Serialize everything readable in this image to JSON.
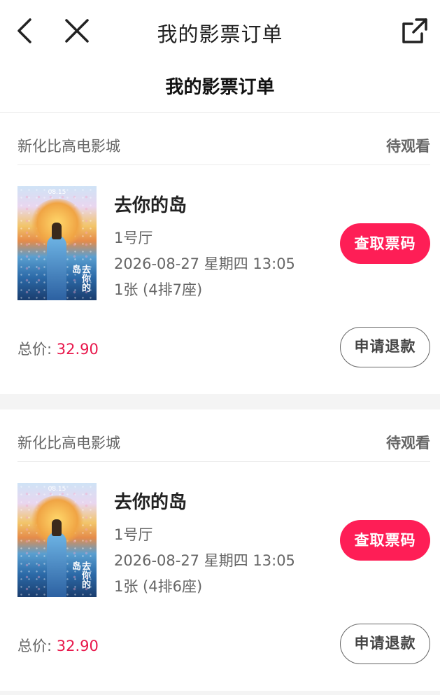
{
  "header": {
    "title": "我的影票订单",
    "back_icon": "chevron-left-icon",
    "close_icon": "close-icon",
    "share_icon": "share-external-icon"
  },
  "page": {
    "heading": "我的影票订单"
  },
  "orders": [
    {
      "cinema": "新化比高电影城",
      "status": "待观看",
      "movie_title": "去你的岛",
      "hall": "1号厅",
      "showtime": "2026-08-27 星期四 13:05",
      "seats": "1张 (4排7座)",
      "pickup_label": "查取票码",
      "total_label": "总价: ",
      "total_amount": "32.90",
      "refund_label": "申请退款",
      "poster_date": "08.15",
      "poster_logo": "去你的岛"
    },
    {
      "cinema": "新化比高电影城",
      "status": "待观看",
      "movie_title": "去你的岛",
      "hall": "1号厅",
      "showtime": "2026-08-27 星期四 13:05",
      "seats": "1张 (4排6座)",
      "pickup_label": "查取票码",
      "total_label": "总价: ",
      "total_amount": "32.90",
      "refund_label": "申请退款",
      "poster_date": "08.15",
      "poster_logo": "去你的岛"
    }
  ],
  "colors": {
    "accent": "#fe1e56",
    "price": "#e8174b",
    "background": "#f4f4f4"
  }
}
